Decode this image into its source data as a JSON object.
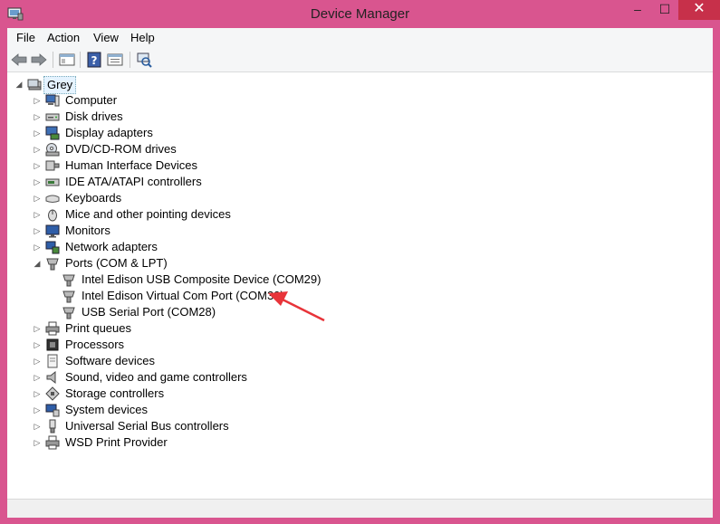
{
  "window": {
    "title": "Device Manager",
    "accent": "#d9558f",
    "close_color": "#c7304a"
  },
  "caption": {
    "minimize": "–",
    "maximize": "☐",
    "close": "✕"
  },
  "menu": {
    "file": "File",
    "action": "Action",
    "view": "View",
    "help": "Help"
  },
  "toolbar": {
    "buttons": [
      "back-icon",
      "forward-icon",
      "properties-icon",
      "help-icon",
      "update-driver-icon",
      "scan-hardware-icon"
    ]
  },
  "tree": {
    "root": "Grey",
    "categories": {
      "computer": "Computer",
      "disk": "Disk drives",
      "display": "Display adapters",
      "dvd": "DVD/CD-ROM drives",
      "hid": "Human Interface Devices",
      "ide": "IDE ATA/ATAPI controllers",
      "keyboards": "Keyboards",
      "mice": "Mice and other pointing devices",
      "monitors": "Monitors",
      "network": "Network adapters",
      "ports": "Ports (COM & LPT)",
      "print": "Print queues",
      "processors": "Processors",
      "software": "Software devices",
      "sound": "Sound, video and game controllers",
      "storage": "Storage controllers",
      "system": "System devices",
      "usb": "Universal Serial Bus controllers",
      "wsd": "WSD Print Provider"
    },
    "ports_children": {
      "com29": "Intel Edison USB Composite Device (COM29)",
      "com30": "Intel Edison Virtual Com Port (COM30)",
      "com28": "USB Serial Port (COM28)"
    }
  },
  "annotation": {
    "arrow_color": "#e8343a"
  }
}
